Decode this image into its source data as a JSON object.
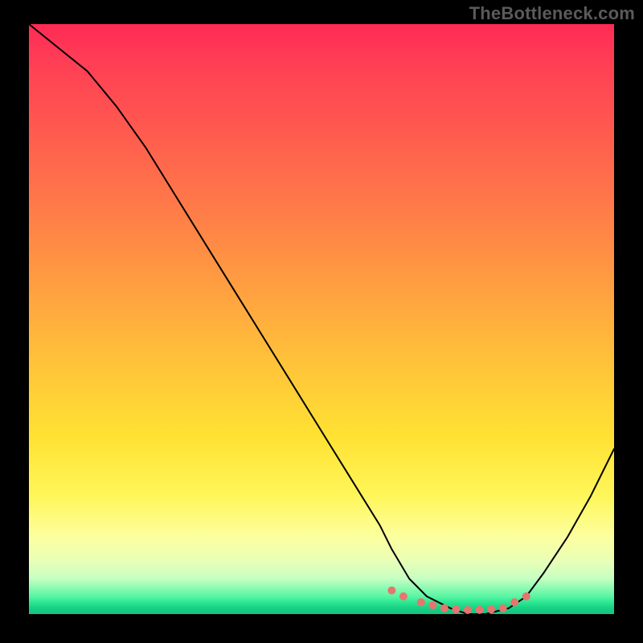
{
  "watermark": "TheBottleneck.com",
  "colors": {
    "background": "#000000",
    "watermark_text": "#5a5a5a",
    "curve_stroke": "#000000",
    "dot_fill": "#e8746e"
  },
  "chart_data": {
    "type": "line",
    "title": "",
    "xlabel": "",
    "ylabel": "",
    "xlim": [
      0,
      100
    ],
    "ylim": [
      0,
      100
    ],
    "grid": false,
    "legend": false,
    "note": "Axes have no visible tick labels in the image; x/y values are normalized 0–100 estimates read from the pixel positions. y=0 is the bottom green band, y=100 is the top edge.",
    "series": [
      {
        "name": "bottleneck-curve",
        "x": [
          0,
          5,
          10,
          15,
          20,
          25,
          30,
          35,
          40,
          45,
          50,
          55,
          60,
          62,
          65,
          68,
          72,
          75,
          78,
          82,
          85,
          88,
          92,
          96,
          100
        ],
        "y": [
          100,
          96,
          92,
          86,
          79,
          71,
          63,
          55,
          47,
          39,
          31,
          23,
          15,
          11,
          6,
          3,
          1,
          0,
          0,
          1,
          3,
          7,
          13,
          20,
          28
        ]
      }
    ],
    "highlight_points": {
      "name": "valley-dots",
      "x": [
        62,
        64,
        67,
        69,
        71,
        73,
        75,
        77,
        79,
        81,
        83,
        85
      ],
      "y": [
        4,
        3,
        2,
        1.5,
        1,
        0.8,
        0.7,
        0.7,
        0.8,
        1,
        2,
        3
      ]
    },
    "background_gradient_stops": [
      {
        "pos": 0.0,
        "color": "#ff2a55"
      },
      {
        "pos": 0.32,
        "color": "#ff7d48"
      },
      {
        "pos": 0.58,
        "color": "#ffc439"
      },
      {
        "pos": 0.8,
        "color": "#fff65a"
      },
      {
        "pos": 0.94,
        "color": "#c6ffc2"
      },
      {
        "pos": 1.0,
        "color": "#15c47e"
      }
    ]
  }
}
